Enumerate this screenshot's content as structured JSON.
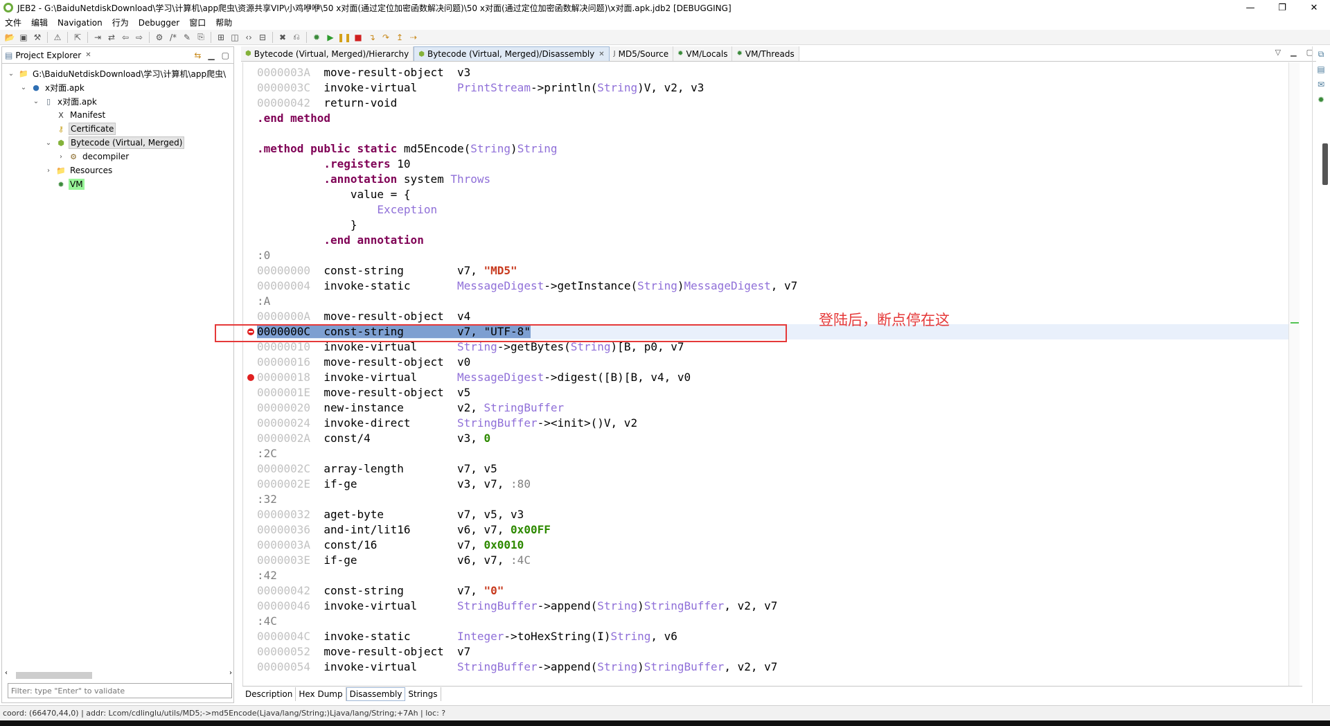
{
  "window": {
    "title": "JEB2 - G:\\BaiduNetdiskDownload\\学习\\计算机\\app爬虫\\资源共享VIP\\小鸡咿咿\\50 x对面(通过定位加密函数解决问题)\\50 x对面(通过定位加密函数解决问题)\\x对面.apk.jdb2 [DEBUGGING]",
    "minimize": "—",
    "maximize": "❐",
    "close": "✕"
  },
  "menus": [
    "文件",
    "编辑",
    "Navigation",
    "行为",
    "Debugger",
    "窗口",
    "帮助"
  ],
  "project_explorer": {
    "title": "Project Explorer",
    "tree": [
      {
        "label": "G:\\BaiduNetdiskDownload\\学习\\计算机\\app爬虫\\",
        "depth": 0,
        "twisty": "v",
        "icon": "folder-icon"
      },
      {
        "label": "x对面.apk",
        "depth": 1,
        "twisty": "v",
        "icon": "project-icon"
      },
      {
        "label": "x对面.apk",
        "depth": 2,
        "twisty": "v",
        "icon": "apk-icon"
      },
      {
        "label": "Manifest",
        "depth": 3,
        "twisty": "",
        "icon": "xml-icon"
      },
      {
        "label": "Certificate",
        "depth": 3,
        "twisty": "",
        "icon": "key-icon"
      },
      {
        "label": "Bytecode (Virtual, Merged)",
        "depth": 3,
        "twisty": "v",
        "icon": "android-icon"
      },
      {
        "label": "decompiler",
        "depth": 4,
        "twisty": ">",
        "icon": "gears-icon"
      },
      {
        "label": "Resources",
        "depth": 3,
        "twisty": ">",
        "icon": "folder-icon"
      },
      {
        "label": "VM",
        "depth": 3,
        "twisty": "",
        "icon": "bug-icon"
      }
    ],
    "filter_placeholder": "Filter: type \"Enter\" to validate"
  },
  "editor_tabs": [
    {
      "label": "Bytecode (Virtual, Merged)/Hierarchy",
      "active": false,
      "closable": false
    },
    {
      "label": "Bytecode (Virtual, Merged)/Disassembly",
      "active": true,
      "closable": true
    },
    {
      "label": "MD5/Source",
      "active": false,
      "closable": false
    },
    {
      "label": "VM/Locals",
      "active": false,
      "closable": false
    },
    {
      "label": "VM/Threads",
      "active": false,
      "closable": false
    }
  ],
  "code": [
    [
      {
        "t": "addr",
        "v": "0000003A  "
      },
      {
        "t": "instr",
        "v": "move-result-object  "
      },
      {
        "t": "plain",
        "v": "v3"
      }
    ],
    [
      {
        "t": "addr",
        "v": "0000003C  "
      },
      {
        "t": "instr",
        "v": "invoke-virtual      "
      },
      {
        "t": "ty",
        "v": "PrintStream"
      },
      {
        "t": "plain",
        "v": "->println("
      },
      {
        "t": "ty",
        "v": "String"
      },
      {
        "t": "plain",
        "v": ")V, v2, v3"
      }
    ],
    [
      {
        "t": "addr",
        "v": "00000042  "
      },
      {
        "t": "instr",
        "v": "return-void"
      }
    ],
    [
      {
        "t": "kw",
        "v": ".end method"
      }
    ],
    [
      {
        "t": "plain",
        "v": ""
      }
    ],
    [
      {
        "t": "kw",
        "v": ".method public static "
      },
      {
        "t": "plain",
        "v": "md5Encode("
      },
      {
        "t": "ty",
        "v": "String"
      },
      {
        "t": "plain",
        "v": ")"
      },
      {
        "t": "ty",
        "v": "String"
      }
    ],
    [
      {
        "t": "plain",
        "v": "          "
      },
      {
        "t": "kw",
        "v": ".registers "
      },
      {
        "t": "plain",
        "v": "10"
      }
    ],
    [
      {
        "t": "plain",
        "v": "          "
      },
      {
        "t": "kw",
        "v": ".annotation "
      },
      {
        "t": "plain",
        "v": "system "
      },
      {
        "t": "ty",
        "v": "Throws"
      }
    ],
    [
      {
        "t": "plain",
        "v": "              value = {"
      }
    ],
    [
      {
        "t": "plain",
        "v": "                  "
      },
      {
        "t": "ty",
        "v": "Exception"
      }
    ],
    [
      {
        "t": "plain",
        "v": "              }"
      }
    ],
    [
      {
        "t": "plain",
        "v": "          "
      },
      {
        "t": "kw",
        "v": ".end annotation"
      }
    ],
    [
      {
        "t": "lbl",
        "v": ":0"
      }
    ],
    [
      {
        "t": "addr",
        "v": "00000000  "
      },
      {
        "t": "instr",
        "v": "const-string        "
      },
      {
        "t": "plain",
        "v": "v7, "
      },
      {
        "t": "str",
        "v": "\"MD5\""
      }
    ],
    [
      {
        "t": "addr",
        "v": "00000004  "
      },
      {
        "t": "instr",
        "v": "invoke-static       "
      },
      {
        "t": "ty",
        "v": "MessageDigest"
      },
      {
        "t": "plain",
        "v": "->getInstance("
      },
      {
        "t": "ty",
        "v": "String"
      },
      {
        "t": "plain",
        "v": ")"
      },
      {
        "t": "ty",
        "v": "MessageDigest"
      },
      {
        "t": "plain",
        "v": ", v7"
      }
    ],
    [
      {
        "t": "lbl",
        "v": ":A"
      }
    ],
    [
      {
        "t": "addr",
        "v": "0000000A  "
      },
      {
        "t": "instr",
        "v": "move-result-object  "
      },
      {
        "t": "plain",
        "v": "v4"
      }
    ],
    [
      {
        "t": "cur",
        "v": "0000000C  const-string        v7, \"UTF-8\""
      }
    ],
    [
      {
        "t": "addr",
        "v": "00000010  "
      },
      {
        "t": "instr",
        "v": "invoke-virtual      "
      },
      {
        "t": "ty",
        "v": "String"
      },
      {
        "t": "plain",
        "v": "->getBytes("
      },
      {
        "t": "ty",
        "v": "String"
      },
      {
        "t": "plain",
        "v": ")[B, p0, v7"
      }
    ],
    [
      {
        "t": "addr",
        "v": "00000016  "
      },
      {
        "t": "instr",
        "v": "move-result-object  "
      },
      {
        "t": "plain",
        "v": "v0"
      }
    ],
    [
      {
        "t": "addr",
        "v": "00000018  "
      },
      {
        "t": "instr",
        "v": "invoke-virtual      "
      },
      {
        "t": "ty",
        "v": "MessageDigest"
      },
      {
        "t": "plain",
        "v": "->digest([B)[B, v4, v0"
      }
    ],
    [
      {
        "t": "addr",
        "v": "0000001E  "
      },
      {
        "t": "instr",
        "v": "move-result-object  "
      },
      {
        "t": "plain",
        "v": "v5"
      }
    ],
    [
      {
        "t": "addr",
        "v": "00000020  "
      },
      {
        "t": "instr",
        "v": "new-instance        "
      },
      {
        "t": "plain",
        "v": "v2, "
      },
      {
        "t": "ty",
        "v": "StringBuffer"
      }
    ],
    [
      {
        "t": "addr",
        "v": "00000024  "
      },
      {
        "t": "instr",
        "v": "invoke-direct       "
      },
      {
        "t": "ty",
        "v": "StringBuffer"
      },
      {
        "t": "plain",
        "v": "-><init>()V, v2"
      }
    ],
    [
      {
        "t": "addr",
        "v": "0000002A  "
      },
      {
        "t": "instr",
        "v": "const/4             "
      },
      {
        "t": "plain",
        "v": "v3, "
      },
      {
        "t": "num",
        "v": "0"
      }
    ],
    [
      {
        "t": "lbl",
        "v": ":2C"
      }
    ],
    [
      {
        "t": "addr",
        "v": "0000002C  "
      },
      {
        "t": "instr",
        "v": "array-length        "
      },
      {
        "t": "plain",
        "v": "v7, v5"
      }
    ],
    [
      {
        "t": "addr",
        "v": "0000002E  "
      },
      {
        "t": "instr",
        "v": "if-ge               "
      },
      {
        "t": "plain",
        "v": "v3, v7, "
      },
      {
        "t": "lbl",
        "v": ":80"
      }
    ],
    [
      {
        "t": "lbl",
        "v": ":32"
      }
    ],
    [
      {
        "t": "addr",
        "v": "00000032  "
      },
      {
        "t": "instr",
        "v": "aget-byte           "
      },
      {
        "t": "plain",
        "v": "v7, v5, v3"
      }
    ],
    [
      {
        "t": "addr",
        "v": "00000036  "
      },
      {
        "t": "instr",
        "v": "and-int/lit16       "
      },
      {
        "t": "plain",
        "v": "v6, v7, "
      },
      {
        "t": "num",
        "v": "0x00FF"
      }
    ],
    [
      {
        "t": "addr",
        "v": "0000003A  "
      },
      {
        "t": "instr",
        "v": "const/16            "
      },
      {
        "t": "plain",
        "v": "v7, "
      },
      {
        "t": "num",
        "v": "0x0010"
      }
    ],
    [
      {
        "t": "addr",
        "v": "0000003E  "
      },
      {
        "t": "instr",
        "v": "if-ge               "
      },
      {
        "t": "plain",
        "v": "v6, v7, "
      },
      {
        "t": "lbl",
        "v": ":4C"
      }
    ],
    [
      {
        "t": "lbl",
        "v": ":42"
      }
    ],
    [
      {
        "t": "addr",
        "v": "00000042  "
      },
      {
        "t": "instr",
        "v": "const-string        "
      },
      {
        "t": "plain",
        "v": "v7, "
      },
      {
        "t": "str",
        "v": "\"0\""
      }
    ],
    [
      {
        "t": "addr",
        "v": "00000046  "
      },
      {
        "t": "instr",
        "v": "invoke-virtual      "
      },
      {
        "t": "ty",
        "v": "StringBuffer"
      },
      {
        "t": "plain",
        "v": "->append("
      },
      {
        "t": "ty",
        "v": "String"
      },
      {
        "t": "plain",
        "v": ")"
      },
      {
        "t": "ty",
        "v": "StringBuffer"
      },
      {
        "t": "plain",
        "v": ", v2, v7"
      }
    ],
    [
      {
        "t": "lbl",
        "v": ":4C"
      }
    ],
    [
      {
        "t": "addr",
        "v": "0000004C  "
      },
      {
        "t": "instr",
        "v": "invoke-static       "
      },
      {
        "t": "ty",
        "v": "Integer"
      },
      {
        "t": "plain",
        "v": "->toHexString(I)"
      },
      {
        "t": "ty",
        "v": "String"
      },
      {
        "t": "plain",
        "v": ", v6"
      }
    ],
    [
      {
        "t": "addr",
        "v": "00000052  "
      },
      {
        "t": "instr",
        "v": "move-result-object  "
      },
      {
        "t": "plain",
        "v": "v7"
      }
    ],
    [
      {
        "t": "addr",
        "v": "00000054  "
      },
      {
        "t": "instr",
        "v": "invoke-virtual      "
      },
      {
        "t": "ty",
        "v": "StringBuffer"
      },
      {
        "t": "plain",
        "v": "->append("
      },
      {
        "t": "ty",
        "v": "String"
      },
      {
        "t": "plain",
        "v": ")"
      },
      {
        "t": "ty",
        "v": "StringBuffer"
      },
      {
        "t": "plain",
        "v": ", v2, v7"
      }
    ]
  ],
  "current_line": 17,
  "breakpoint_lines": [
    17,
    20
  ],
  "annotation": "登陆后，断点停在这",
  "bottom_tabs": [
    {
      "label": "Description",
      "active": false
    },
    {
      "label": "Hex Dump",
      "active": false
    },
    {
      "label": "Disassembly",
      "active": true
    },
    {
      "label": "Strings",
      "active": false
    }
  ],
  "status": "coord: (66470,44,0) | addr: Lcom/cdlinglu/utils/MD5;->md5Encode(Ljava/lang/String;)Ljava/lang/String;+7Ah | loc: ?",
  "colors": {
    "accent_red": "#e53939",
    "keyword": "#7f0055",
    "type": "#8f6fd8"
  }
}
